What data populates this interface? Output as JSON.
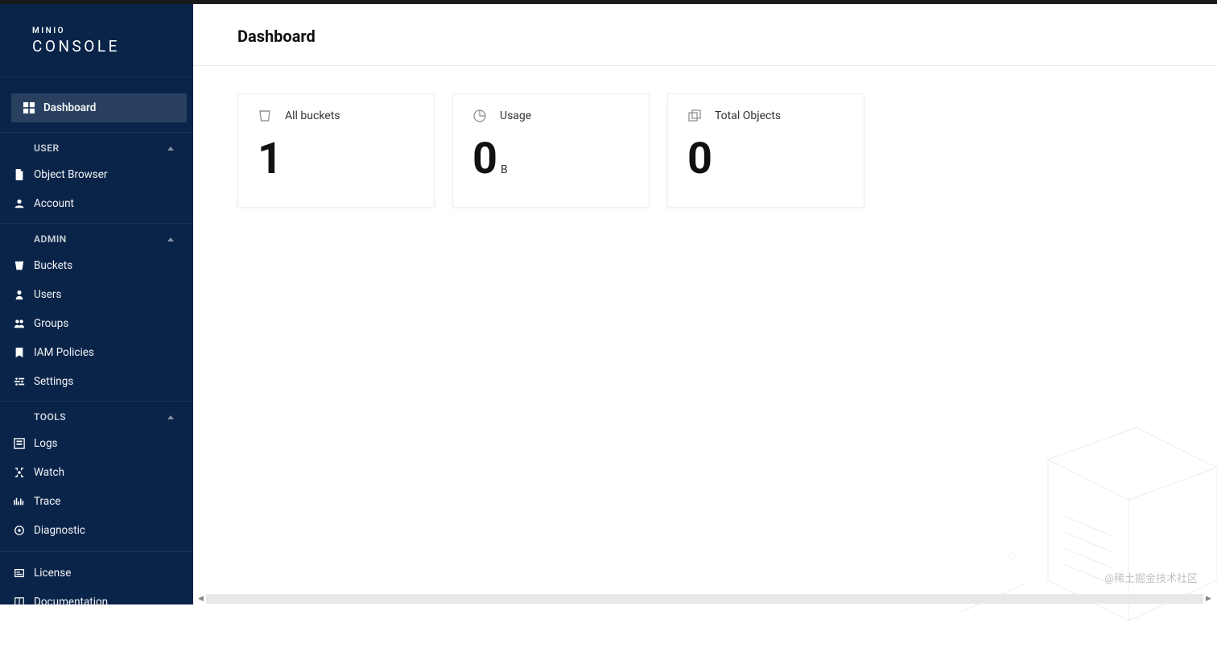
{
  "brand": {
    "top": "MINIO",
    "name": "CONSOLE"
  },
  "header": {
    "title": "Dashboard"
  },
  "sidebar": {
    "dashboard": "Dashboard",
    "sections": {
      "user": {
        "title": "USER",
        "items": [
          "Object Browser",
          "Account"
        ]
      },
      "admin": {
        "title": "ADMIN",
        "items": [
          "Buckets",
          "Users",
          "Groups",
          "IAM Policies",
          "Settings"
        ]
      },
      "tools": {
        "title": "TOOLS",
        "items": [
          "Logs",
          "Watch",
          "Trace",
          "Diagnostic"
        ]
      }
    },
    "bottom": [
      "License",
      "Documentation"
    ]
  },
  "cards": {
    "buckets": {
      "label": "All buckets",
      "value": "1",
      "unit": ""
    },
    "usage": {
      "label": "Usage",
      "value": "0",
      "unit": "B"
    },
    "objects": {
      "label": "Total Objects",
      "value": "0",
      "unit": ""
    }
  },
  "watermark": "@稀土掘金技术社区"
}
